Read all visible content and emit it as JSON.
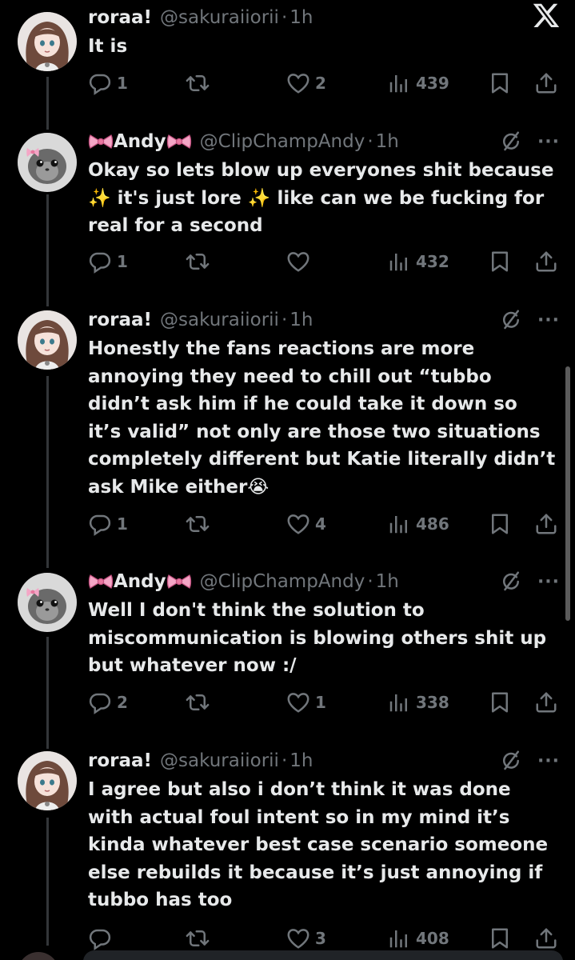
{
  "tweets": [
    {
      "author": "roraa!",
      "handle": "@sakuraiiorii",
      "time": "1h",
      "avatar": "anime-girl-avatar",
      "text": "It is",
      "stats": {
        "replies": "1",
        "retweets": "",
        "likes": "2",
        "views": "439"
      }
    },
    {
      "author": "Andy",
      "handle": "@ClipChampAndy",
      "time": "1h",
      "avatar": "hamster-avatar",
      "text": "Okay so lets blow up everyones shit because ✨ it's just lore ✨ like can we be fucking for real for a second",
      "stats": {
        "replies": "1",
        "retweets": "",
        "likes": "",
        "views": "432"
      }
    },
    {
      "author": "roraa!",
      "handle": "@sakuraiiorii",
      "time": "1h",
      "avatar": "anime-girl-avatar",
      "text": "Honestly the fans reactions are more annoying they need to chill out “tubbo didn’t ask him if he could take it down so it’s valid” not only are those two situations completely different but Katie literally didn’t ask Mike either😭",
      "stats": {
        "replies": "1",
        "retweets": "",
        "likes": "4",
        "views": "486"
      }
    },
    {
      "author": "Andy",
      "handle": "@ClipChampAndy",
      "time": "1h",
      "avatar": "hamster-avatar",
      "text": "Well I don't think the solution to miscommunication is blowing others shit up but whatever now :/",
      "stats": {
        "replies": "2",
        "retweets": "",
        "likes": "1",
        "views": "338"
      }
    },
    {
      "author": "roraa!",
      "handle": "@sakuraiiorii",
      "time": "1h",
      "avatar": "anime-girl-avatar",
      "text": "I agree but also i don’t think it was done with actual foul intent so in my mind it’s kinda whatever best case scenario someone else rebuilds it because it’s just annoying if tubbo has too",
      "stats": {
        "replies": "",
        "retweets": "",
        "likes": "3",
        "views": "408"
      }
    }
  ],
  "icons": {
    "app_logo": "x-logo-icon",
    "reply": "reply-icon",
    "retweet": "retweet-icon",
    "like": "heart-icon",
    "views": "views-icon",
    "bookmark": "bookmark-icon",
    "share": "share-icon",
    "grok": "grok-icon",
    "more": "more-icon"
  },
  "colors": {
    "background": "#000000",
    "text": "#e7e9ea",
    "muted": "#71767b"
  }
}
